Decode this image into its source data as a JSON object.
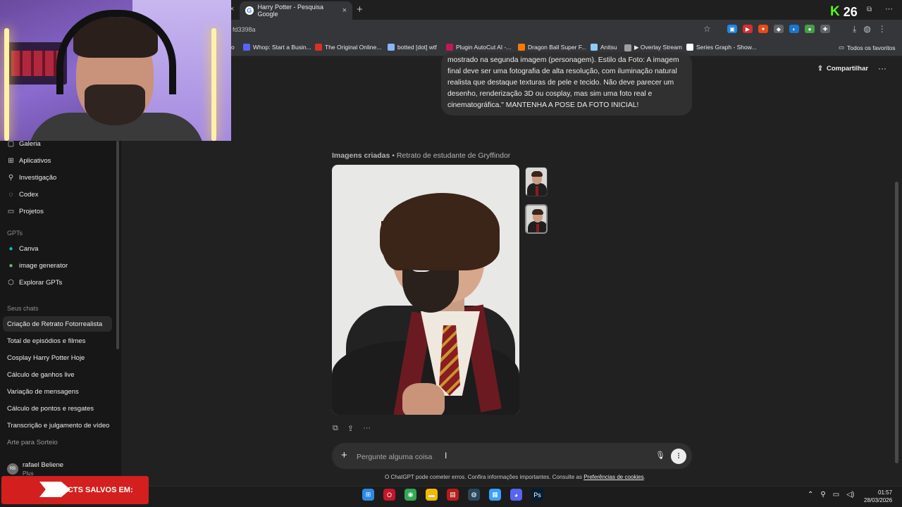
{
  "browser": {
    "tab_title": "Harry Potter - Pesquisa Google",
    "tab_close": "×",
    "prev_tab_close": "×",
    "new_tab": "+",
    "url_fragment": "fd3398a",
    "kick_count": "26",
    "bookmarks": [
      {
        "label": "o",
        "color": "#35363a"
      },
      {
        "label": "Whop: Start a Busin...",
        "color": "#5865f2"
      },
      {
        "label": "The Original Online...",
        "color": "#d93025"
      },
      {
        "label": "botted [dot] wtf",
        "color": "#8ab4f8"
      },
      {
        "label": "Plugin AutoCut AI -...",
        "color": "#c2185b"
      },
      {
        "label": "Dragon Ball Super F...",
        "color": "#f57c00"
      },
      {
        "label": "Anitsu",
        "color": "#90caf9"
      },
      {
        "label": "▶ Overlay Stream",
        "color": "#9e9e9e"
      },
      {
        "label": "Series Graph - Show...",
        "color": "#ffffff"
      }
    ],
    "all_bookmarks": "Todos os favoritos"
  },
  "sidebar": {
    "items_top": [
      {
        "label": "Galeria",
        "icon": "gallery-icon",
        "glyph": "▢"
      },
      {
        "label": "Aplicativos",
        "icon": "apps-icon",
        "glyph": "⊞"
      },
      {
        "label": "Investigação",
        "icon": "research-icon",
        "glyph": "⚲"
      },
      {
        "label": "Codex",
        "icon": "codex-icon",
        "glyph": "◌"
      },
      {
        "label": "Projetos",
        "icon": "folder-icon",
        "glyph": "▭"
      }
    ],
    "gpts_title": "GPTs",
    "gpts": [
      {
        "label": "Canva",
        "icon": "canva-icon",
        "glyph": "●"
      },
      {
        "label": "image generator",
        "icon": "image-generator-icon",
        "glyph": "●"
      },
      {
        "label": "Explorar GPTs",
        "icon": "explore-gpts-icon",
        "glyph": "⬡"
      }
    ],
    "chats_title": "Seus chats",
    "chats": [
      "Criação de Retrato Fotorrealista",
      "Total de episódios e filmes",
      "Cosplay Harry Potter Hoje",
      "Cálculo de ganhos live",
      "Variação de mensagens",
      "Cálculo de pontos e resgates",
      "Transcrição e julgamento de vídeo",
      "Arte para Sorteio"
    ],
    "user": {
      "name": "rafael Beliene",
      "plan": "Plus",
      "initials": "RB"
    }
  },
  "header": {
    "share_label": "Compartilhar",
    "more": "···"
  },
  "message": {
    "lines": [
      "mostrado na segunda imagem (personagem). Estilo da Foto: A imagem",
      "final deve ser uma fotografia de alta resolução, com iluminação natural",
      "realista que destaque texturas de pele e tecido. Não deve parecer um",
      "desenho, renderização 3D ou cosplay, mas sim uma foto real e",
      "cinematográfica.\" MANTENHA A POSE DA FOTO INICIAL!"
    ]
  },
  "image_result": {
    "label": "Imagens criadas",
    "separator": " • ",
    "title": "Retrato de estudante de Gryffindor"
  },
  "composer": {
    "placeholder": "Pergunte alguma coisa",
    "plus": "+",
    "disclaimer": "O ChatGPT pode cometer erros. Confira informações importantes. Consulte as ",
    "cookie_link": "Preferências de cookies",
    "disclaimer_end": "."
  },
  "banner": {
    "text": "ACTS SALVOS EM:"
  },
  "taskbar": {
    "apps": [
      {
        "name": "windows-start-icon",
        "color": "#2b8ae6",
        "glyph": "⊞"
      },
      {
        "name": "opera-icon",
        "color": "#c4162a",
        "glyph": "O"
      },
      {
        "name": "chrome-icon",
        "color": "#34a853",
        "glyph": "◉"
      },
      {
        "name": "explorer-icon",
        "color": "#f5b800",
        "glyph": "▬"
      },
      {
        "name": "media-app-icon",
        "color": "#b71c1c",
        "glyph": "▤"
      },
      {
        "name": "steam-icon",
        "color": "#2a475e",
        "glyph": "◍"
      },
      {
        "name": "notepad-icon",
        "color": "#3aa0ff",
        "glyph": "▦"
      },
      {
        "name": "discord-icon",
        "color": "#5865f2",
        "glyph": "◕"
      },
      {
        "name": "photoshop-icon",
        "color": "#001e36",
        "glyph": "Ps"
      }
    ],
    "time": "01:57",
    "date": "28/03/2026"
  }
}
